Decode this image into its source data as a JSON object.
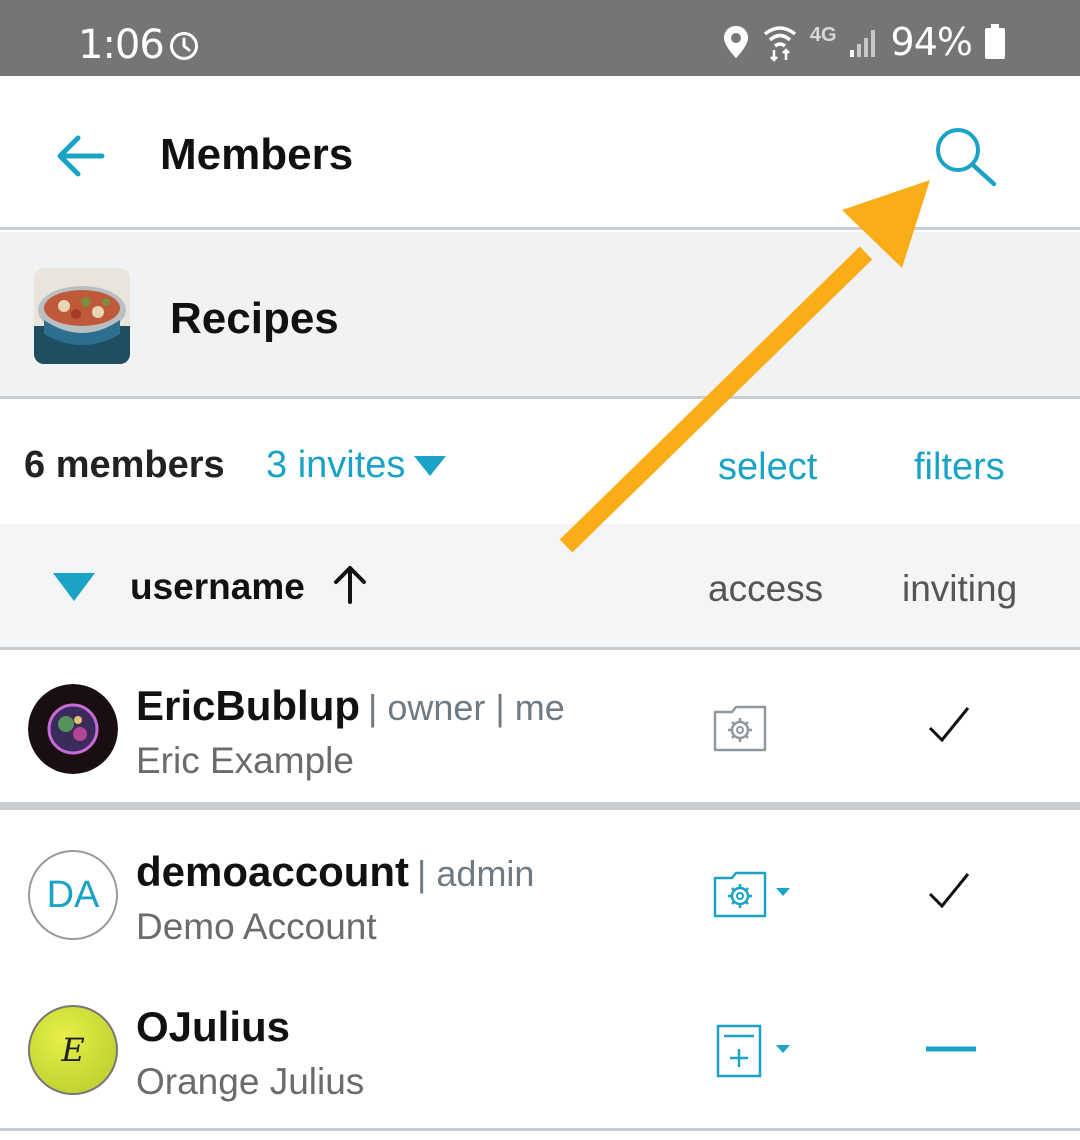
{
  "status_bar": {
    "time": "1:06",
    "network": "4G",
    "battery": "94%"
  },
  "app_bar": {
    "back_icon": "arrow-left-icon",
    "title": "Members",
    "search_icon": "search-icon"
  },
  "group": {
    "name": "Recipes",
    "thumbnail": "food-pot-image"
  },
  "summary": {
    "members_count": "6 members",
    "invites": "3 invites",
    "select": "select",
    "filters": "filters"
  },
  "table_header": {
    "username": "username",
    "access": "access",
    "inviting": "inviting",
    "sort": "ascending"
  },
  "members": [
    {
      "username": "EricBublup",
      "roles": "| owner | me",
      "full_name": "Eric Example",
      "access": "folder-gear-icon",
      "inviting": "check-icon"
    },
    {
      "username": "demoaccount",
      "roles": "| admin",
      "full_name": "Demo Account",
      "avatar_initials": "DA",
      "access": "folder-gear-dropdown-icon",
      "inviting": "check-icon"
    },
    {
      "username": "OJulius",
      "roles": "",
      "full_name": "Orange Julius",
      "avatar_initials": "E",
      "access": "doc-plus-dropdown-icon",
      "inviting": "dash-icon"
    }
  ],
  "colors": {
    "accent": "#1aa3c7",
    "status_bar": "#757575",
    "callout_arrow": "#fbad18",
    "divider": "#c9ced3"
  }
}
